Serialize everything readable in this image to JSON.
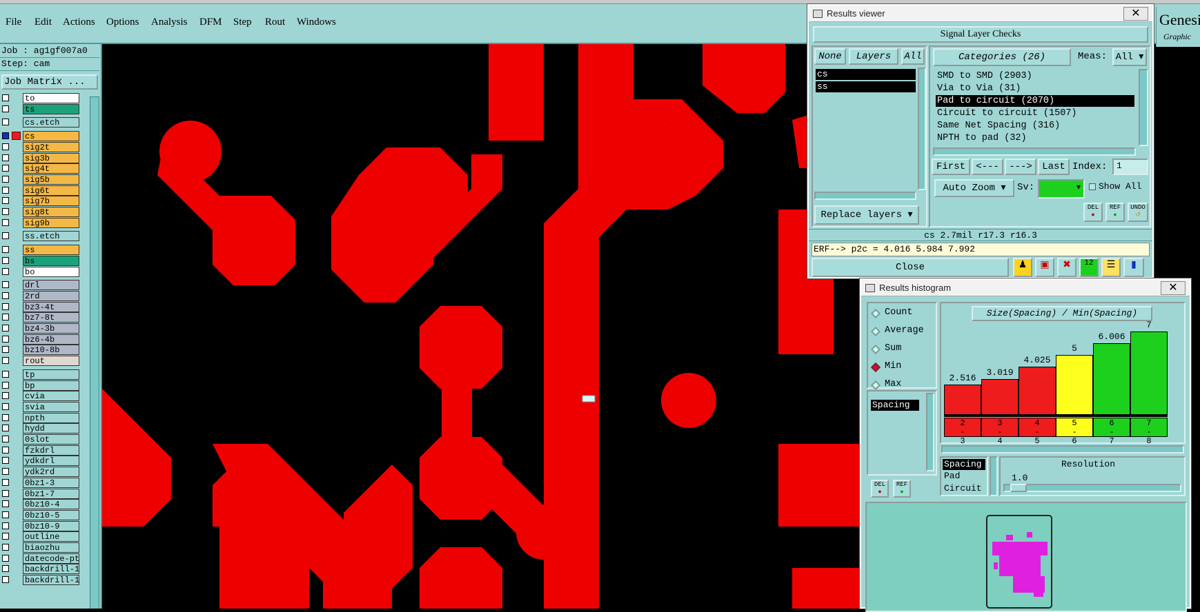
{
  "menu": {
    "items": [
      "File",
      "Edit",
      "Actions",
      "Options",
      "Analysis",
      "DFM",
      "Step",
      "Rout",
      "Windows"
    ],
    "brand": "Genesi",
    "brand_sub": "Graphic"
  },
  "left_panel": {
    "job": "Job : ag1gf007a0",
    "step": "Step: cam",
    "job_matrix": "Job Matrix ...",
    "layers": [
      {
        "name": "to",
        "color": "#ffffff"
      },
      {
        "name": "ts",
        "color": "#1aa37a"
      },
      {
        "name": "cs.etch",
        "color": "#9fd6d4"
      },
      {
        "name": "cs",
        "color": "#f4b845"
      },
      {
        "name": "sig2t",
        "color": "#f4b845"
      },
      {
        "name": "sig3b",
        "color": "#f4b845"
      },
      {
        "name": "sig4t",
        "color": "#f4b845"
      },
      {
        "name": "sig5b",
        "color": "#f4b845"
      },
      {
        "name": "sig6t",
        "color": "#f4b845"
      },
      {
        "name": "sig7b",
        "color": "#f4b845"
      },
      {
        "name": "sig8t",
        "color": "#f4b845"
      },
      {
        "name": "sig9b",
        "color": "#f4b845"
      },
      {
        "name": "ss.etch",
        "color": "#9fd6d4"
      },
      {
        "name": "ss",
        "color": "#f4b845"
      },
      {
        "name": "bs",
        "color": "#1aa37a"
      },
      {
        "name": "bo",
        "color": "#ffffff"
      },
      {
        "name": "drl",
        "color": "#b0b8c8"
      },
      {
        "name": "2rd",
        "color": "#b0b8c8"
      },
      {
        "name": "bz3-4t",
        "color": "#b0b8c8"
      },
      {
        "name": "bz7-8t",
        "color": "#b0b8c8"
      },
      {
        "name": "bz4-3b",
        "color": "#b0b8c8"
      },
      {
        "name": "bz6-4b",
        "color": "#b0b8c8"
      },
      {
        "name": "bz10-8b",
        "color": "#b0b8c8"
      },
      {
        "name": "rout",
        "color": "#e0d8d0"
      },
      {
        "name": "tp",
        "color": "#9fd6d4"
      },
      {
        "name": "bp",
        "color": "#9fd6d4"
      },
      {
        "name": "cvia",
        "color": "#9fd6d4"
      },
      {
        "name": "svia",
        "color": "#9fd6d4"
      },
      {
        "name": "npth",
        "color": "#9fd6d4"
      },
      {
        "name": "hydd",
        "color": "#9fd6d4"
      },
      {
        "name": "0slot",
        "color": "#9fd6d4"
      },
      {
        "name": "fzkdrl",
        "color": "#9fd6d4"
      },
      {
        "name": "ydkdrl",
        "color": "#9fd6d4"
      },
      {
        "name": "ydk2rd",
        "color": "#9fd6d4"
      },
      {
        "name": "0bz1-3",
        "color": "#9fd6d4"
      },
      {
        "name": "0bz1-7",
        "color": "#9fd6d4"
      },
      {
        "name": "0bz10-4",
        "color": "#9fd6d4"
      },
      {
        "name": "0bz10-5",
        "color": "#9fd6d4"
      },
      {
        "name": "0bz10-9",
        "color": "#9fd6d4"
      },
      {
        "name": "outline",
        "color": "#9fd6d4"
      },
      {
        "name": "biaozhu",
        "color": "#9fd6d4"
      },
      {
        "name": "datecode-pte",
        "color": "#9fd6d4"
      },
      {
        "name": "backdrill-1",
        "color": "#9fd6d4"
      },
      {
        "name": "backdrill-1.",
        "color": "#9fd6d4"
      }
    ]
  },
  "results_viewer": {
    "title": "Results viewer",
    "header": "Signal Layer Checks",
    "none": "None",
    "layers": "Layers",
    "all": "All",
    "layer_list": [
      "cs",
      "ss"
    ],
    "categories": "Categories (26)",
    "meas_label": "Meas:",
    "meas_value": "All",
    "category_list": [
      "SMD to SMD (2903)",
      "Via to Via (31)",
      "Pad to circuit (2070)",
      "Circuit to circuit (1507)",
      "Same Net Spacing (316)",
      "NPTH to pad (32)"
    ],
    "first": "First",
    "prev": "<---",
    "next": "--->",
    "last": "Last",
    "index_label": "Index:",
    "index_value": "1",
    "auto_zoom": "Auto Zoom",
    "sv_label": "Sv:",
    "show_all": "Show All",
    "replace_layers": "Replace layers",
    "del": "DEL",
    "ref": "REF",
    "undo": "UNDO",
    "status": "cs 2.7mil  r17.3  r16.3",
    "erf": "ERF--> p2c = 4.016 5.984 7.992",
    "close": "Close",
    "sv_color": "#1ed01e"
  },
  "histogram": {
    "title": "Results histogram",
    "modes": [
      "Count",
      "Average",
      "Sum",
      "Min",
      "Max"
    ],
    "selected_mode": "Min",
    "list_selected": "Spacing",
    "chart_title": "Size(Spacing) / Min(Spacing)",
    "del": "DEL",
    "ref": "REF",
    "types": [
      "Spacing",
      "Pad",
      "Circuit"
    ],
    "resolution_label": "Resolution",
    "resolution_value": "1.0",
    "chart_data": {
      "type": "bar",
      "categories": [
        "2-3",
        "3-4",
        "4-5",
        "5-6",
        "6-7",
        "7-8"
      ],
      "values": [
        2.516,
        3.019,
        4.025,
        5,
        6.006,
        7
      ],
      "labels": [
        "2.516",
        "3.019",
        "4.025",
        "5",
        "6.006",
        "7"
      ],
      "colors": [
        "#ee1c1c",
        "#ee1c1c",
        "#ee1c1c",
        "#ffff1e",
        "#1ed01e",
        "#1ed01e"
      ]
    }
  }
}
